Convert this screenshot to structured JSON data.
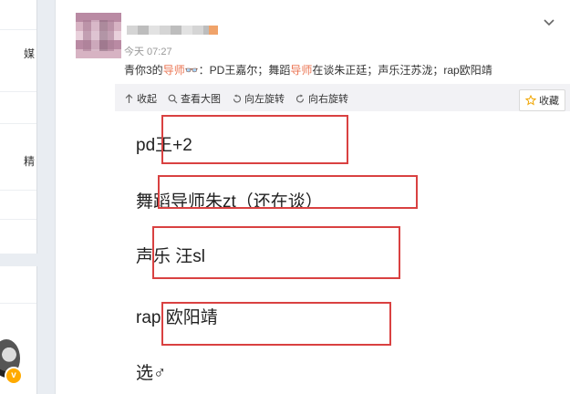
{
  "left_panel": {
    "items": [
      "媒",
      "精"
    ]
  },
  "post": {
    "timestamp": "今天 07:27",
    "text_parts": [
      "青你3的",
      "导师",
      "👓：PD王嘉尔；舞蹈",
      "导师",
      "在谈朱正廷；声乐汪苏泷；rap欧阳靖"
    ]
  },
  "toolbar": {
    "collapse": "收起",
    "view_large": "查看大图",
    "rotate_left": "向左旋转",
    "rotate_right": "向右旋转",
    "favorite": "收藏"
  },
  "image_lines": [
    "pd王+2",
    "舞蹈导师朱zt（还在谈）",
    "声乐 汪sl",
    "rap 欧阳靖",
    "选♂"
  ],
  "colors": {
    "highlight": "#eb7350",
    "annotation_red": "#d94141"
  }
}
